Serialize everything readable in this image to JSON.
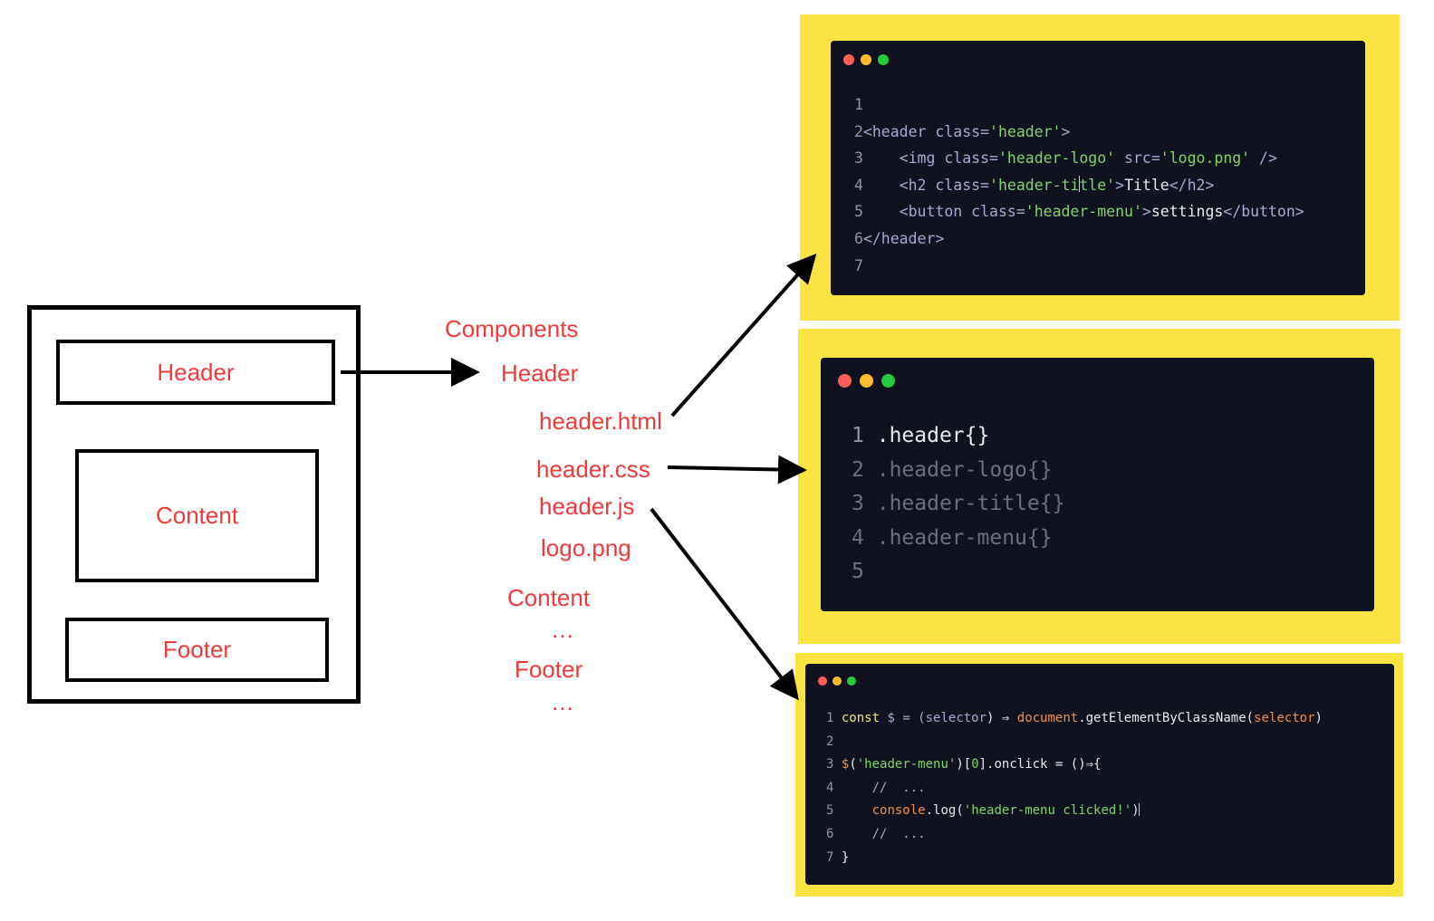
{
  "page_layout": {
    "box_labels": {
      "header": "Header",
      "content": "Content",
      "footer": "Footer"
    }
  },
  "file_tree": {
    "components": "Components",
    "header": "Header",
    "files": [
      "header.html",
      "header.css",
      "header.js",
      "logo.png"
    ],
    "content": "Content",
    "content_more": "…",
    "footer": "Footer",
    "footer_more": "…"
  },
  "colors": {
    "label_red": "#f03a3a",
    "panel_yellow": "#f9e442",
    "editor_bg": "#10131f",
    "dot_red": "#ff5f56",
    "dot_yellow": "#ffbd2e",
    "dot_green": "#27c93f"
  },
  "html_editor": {
    "line_numbers": [
      "1",
      "2",
      "3",
      "4",
      "5",
      "6",
      "7"
    ],
    "line2": {
      "open": "<header class=",
      "cls": "'header'",
      "close": ">"
    },
    "line3": {
      "indent": "    ",
      "open": "<img class=",
      "cls": "'header-logo'",
      "src_attr": " src=",
      "src": "'logo.png'",
      "close": " />"
    },
    "line4": {
      "indent": "    ",
      "open": "<h2 class=",
      "cls_a": "'header-ti",
      "cls_b": "tle'",
      "close": ">",
      "text": "Title",
      "end": "</h2>"
    },
    "line5": {
      "indent": "    ",
      "open": "<button class=",
      "cls": "'header-menu'",
      "close": ">",
      "text": "settings",
      "end": "</button>"
    },
    "line6": {
      "end": "</header>"
    }
  },
  "css_editor": {
    "line_numbers": [
      "1",
      "2",
      "3",
      "4",
      "5"
    ],
    "lines": [
      ".header{}",
      ".header-logo{}",
      ".header-title{}",
      ".header-menu{}"
    ]
  },
  "js_editor": {
    "line_numbers": [
      "1",
      "2",
      "3",
      "4",
      "5",
      "6",
      "7"
    ],
    "line1": {
      "kw": "const",
      "var": " $ = (",
      "param": "selector",
      "arrow": ") ⇒ ",
      "obj": "document",
      "method": ".getElementByClassName(",
      "arg": "selector",
      "close": ")"
    },
    "line3": {
      "fn": "$",
      "open": "(",
      "str": "'header-menu'",
      "idx_open": ")[",
      "idx": "0",
      "rest": "].onclick = ()⇒{"
    },
    "line4": {
      "indent": "    ",
      "comment": "//  ..."
    },
    "line5": {
      "indent": "    ",
      "obj": "console",
      "method": ".log(",
      "str": "'header-menu clicked!'",
      "close": ")"
    },
    "line6": {
      "indent": "    ",
      "comment": "//  ..."
    },
    "line7": {
      "close": "}"
    }
  }
}
